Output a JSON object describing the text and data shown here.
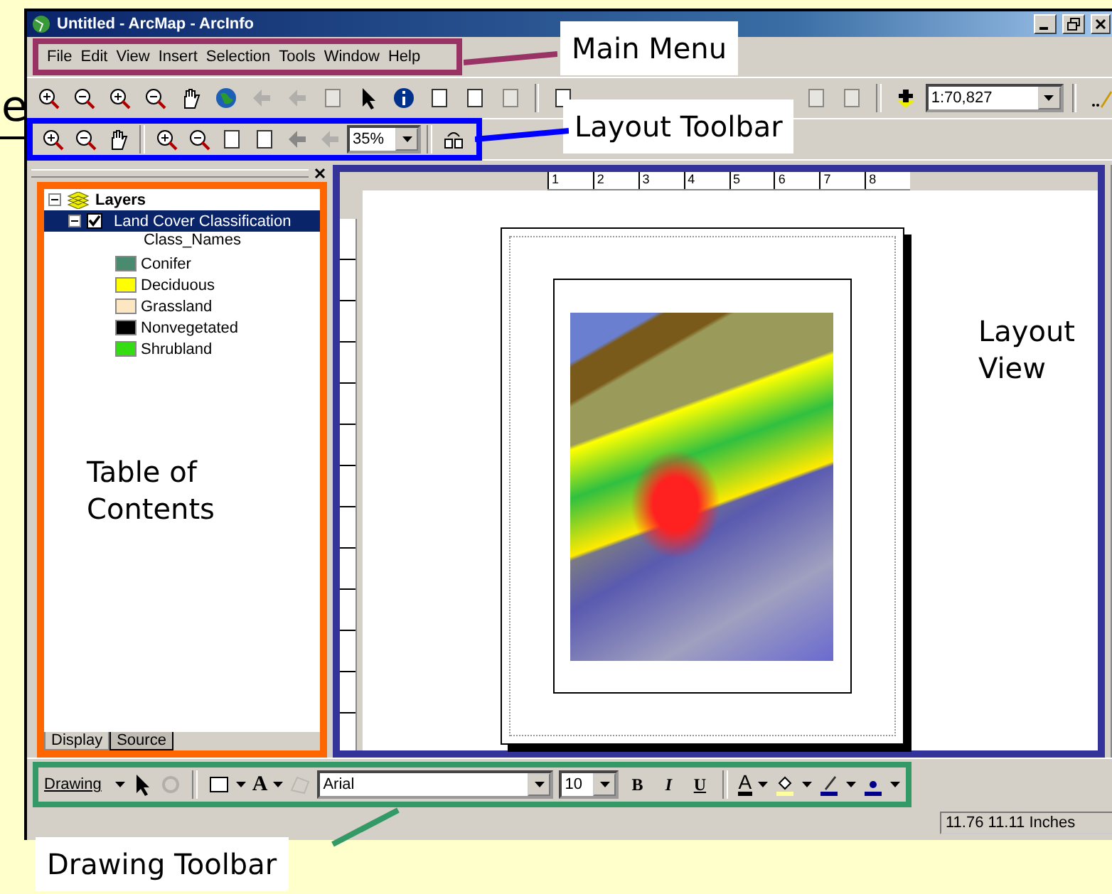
{
  "slide_fragment": "e",
  "window": {
    "title": "Untitled - ArcMap - ArcInfo"
  },
  "menu": {
    "items": [
      "File",
      "Edit",
      "View",
      "Insert",
      "Selection",
      "Tools",
      "Window",
      "Help"
    ],
    "callout": {
      "label": "Main Menu",
      "color": "#993366"
    }
  },
  "standard_toolbar": {
    "scale": "1:70,827"
  },
  "layout_toolbar": {
    "zoom": "35%",
    "callout": {
      "label": "Layout Toolbar",
      "color": "#0000ff"
    }
  },
  "toc": {
    "root": "Layers",
    "layers": [
      {
        "name": "Land Cover Classification",
        "checked": true,
        "selected": true,
        "field": "Class_Names",
        "classes": [
          {
            "label": "Conifer",
            "color": "#4a8a6e"
          },
          {
            "label": "Deciduous",
            "color": "#ffff00"
          },
          {
            "label": "Grassland",
            "color": "#fde6c2"
          },
          {
            "label": "Nonvegetated",
            "color": "#000000"
          },
          {
            "label": "Shrubland",
            "color": "#33dd11"
          }
        ]
      }
    ],
    "tabs": [
      {
        "label": "Display",
        "selected": true
      },
      {
        "label": "Source",
        "selected": false
      }
    ],
    "callout": {
      "label": "Table of Contents",
      "color": "#ff6600"
    }
  },
  "layout_view": {
    "ruler": [
      "1",
      "2",
      "3",
      "4",
      "5",
      "6",
      "7",
      "8"
    ],
    "callout": {
      "label": "Layout View",
      "color": "#333399"
    }
  },
  "drawing_toolbar": {
    "menu": "Drawing",
    "text_tool": "A",
    "font": "Arial",
    "size": "10",
    "bold": "B",
    "italic": "I",
    "underline": "U",
    "font_color": "A",
    "callout": {
      "label": "Drawing Toolbar",
      "color": "#339966"
    }
  },
  "status_bar": {
    "coordinates": "11.76  11.11 Inches"
  }
}
